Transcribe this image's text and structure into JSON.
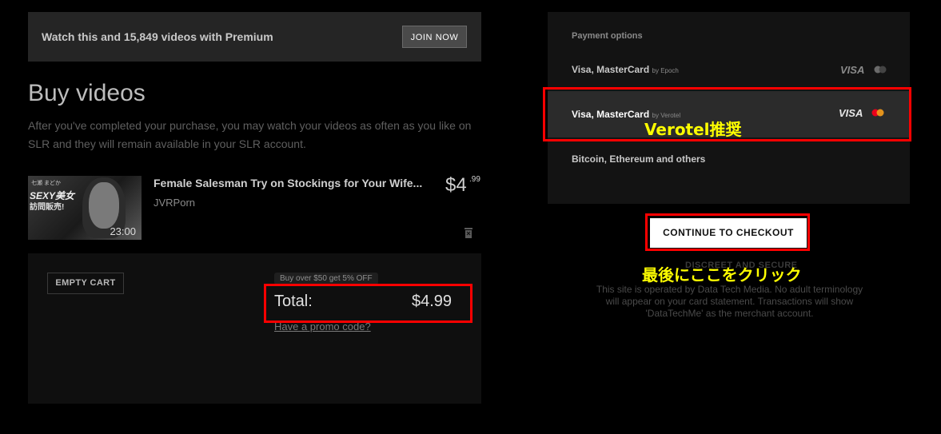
{
  "premium_banner": {
    "text": "Watch this and 15,849 videos with Premium",
    "join_label": "JOIN NOW"
  },
  "buy": {
    "title": "Buy videos",
    "description": "After you've completed your purchase, you may watch your videos as often as you like on SLR and they will remain available in your SLR account."
  },
  "cart_item": {
    "title": "Female Salesman Try on Stockings for Your Wife...",
    "studio": "JVRPorn",
    "price_main": "$4",
    "price_cents": ".99",
    "duration": "23:00",
    "thumb_text_1": "SEXY美女",
    "thumb_text_2": "訪問販売!",
    "thumb_text_0": "七瀬 まどか"
  },
  "cart_panel": {
    "empty_cart_label": "EMPTY CART",
    "discount_badge": "Buy over $50 get 5% OFF",
    "total_label": "Total:",
    "total_value": "$4.99",
    "promo_link": "Have a promo code?"
  },
  "payment": {
    "heading": "Payment options",
    "options": [
      {
        "label": "Visa, MasterCard",
        "provider": "by Epoch",
        "selected": false
      },
      {
        "label": "Visa, MasterCard",
        "provider": "by Verotel",
        "selected": true
      },
      {
        "label": "Bitcoin, Ethereum and others"
      }
    ],
    "visa_text": "VISA"
  },
  "checkout": {
    "button_label": "CONTINUE TO CHECKOUT",
    "secure_title": "DISCREET AND SECURE",
    "secure_text": "This site is operated by Data Tech Media. No adult terminology will appear on your card statement. Transactions will show 'DataTechMe' as the merchant account."
  },
  "annotations": {
    "verotel_note": "Verotel推奨",
    "checkout_note": "最後にここをクリック"
  },
  "colors": {
    "background": "#000000",
    "annotation_red": "#ff0000",
    "annotation_yellow": "#ffff00",
    "mastercard_red": "#eb001b",
    "mastercard_orange": "#f79e1b"
  }
}
